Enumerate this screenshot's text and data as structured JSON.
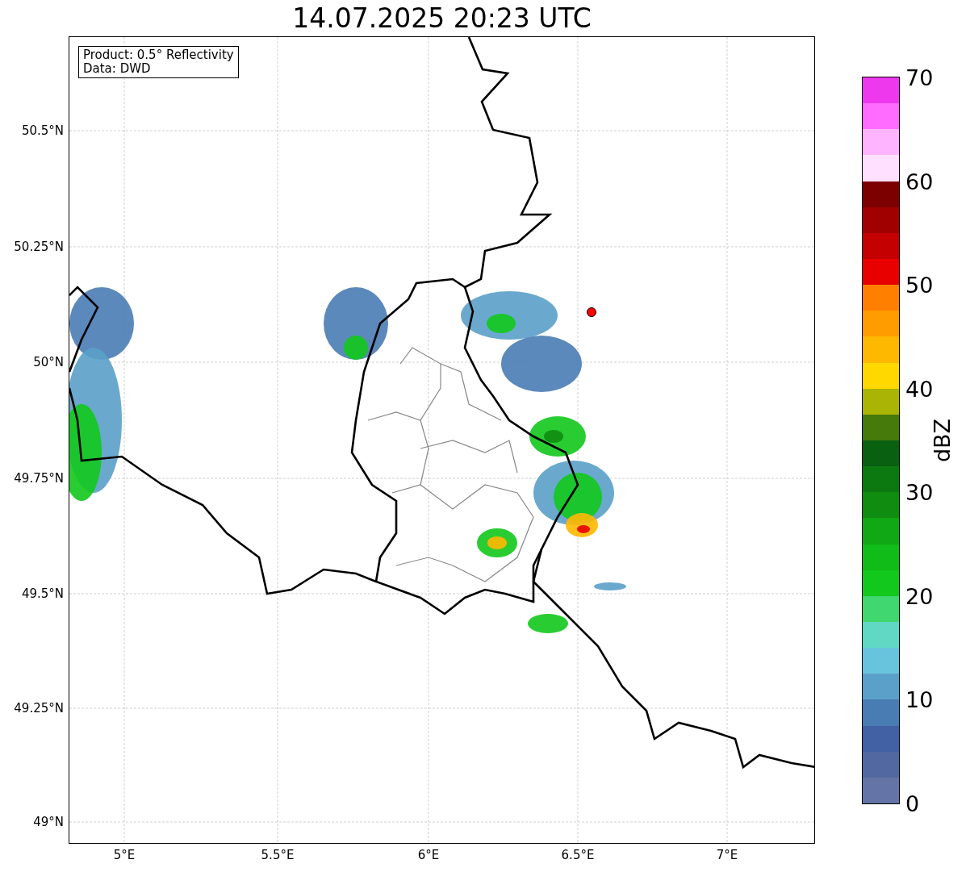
{
  "title": "14.07.2025 20:23 UTC",
  "info_box": {
    "lines": [
      "Product: 0.5° Reflectivity",
      "Data: DWD"
    ]
  },
  "lat_ticks": [
    "50.5°N",
    "50.25°N",
    "50°N",
    "49.75°N",
    "49.5°N",
    "49.25°N",
    "49°N"
  ],
  "lon_ticks": [
    "5°E",
    "5.5°E",
    "6°E",
    "6.5°E",
    "7°E"
  ],
  "colorbar": {
    "label": "dBZ",
    "ticks": [
      "70",
      "60",
      "50",
      "40",
      "30",
      "20",
      "10",
      "0"
    ],
    "bands": [
      {
        "color": "#6574a6"
      },
      {
        "color": "#5268a0"
      },
      {
        "color": "#4260a4"
      },
      {
        "color": "#4a7cb4"
      },
      {
        "color": "#5aa0c8"
      },
      {
        "color": "#68c4dc"
      },
      {
        "color": "#60d8c4"
      },
      {
        "color": "#40d670"
      },
      {
        "color": "#12c81c"
      },
      {
        "color": "#10bc18"
      },
      {
        "color": "#10a814"
      },
      {
        "color": "#108c10"
      },
      {
        "color": "#0c7810"
      },
      {
        "color": "#086010"
      },
      {
        "color": "#467a0a"
      },
      {
        "color": "#aab404"
      },
      {
        "color": "#ffd800"
      },
      {
        "color": "#ffb800"
      },
      {
        "color": "#ff9c00"
      },
      {
        "color": "#ff8000"
      },
      {
        "color": "#e80000"
      },
      {
        "color": "#c40000"
      },
      {
        "color": "#a00000"
      },
      {
        "color": "#7c0000"
      },
      {
        "color": "#ffe0ff"
      },
      {
        "color": "#ffb4ff"
      },
      {
        "color": "#ff6cff"
      },
      {
        "color": "#ee38ee"
      }
    ]
  }
}
